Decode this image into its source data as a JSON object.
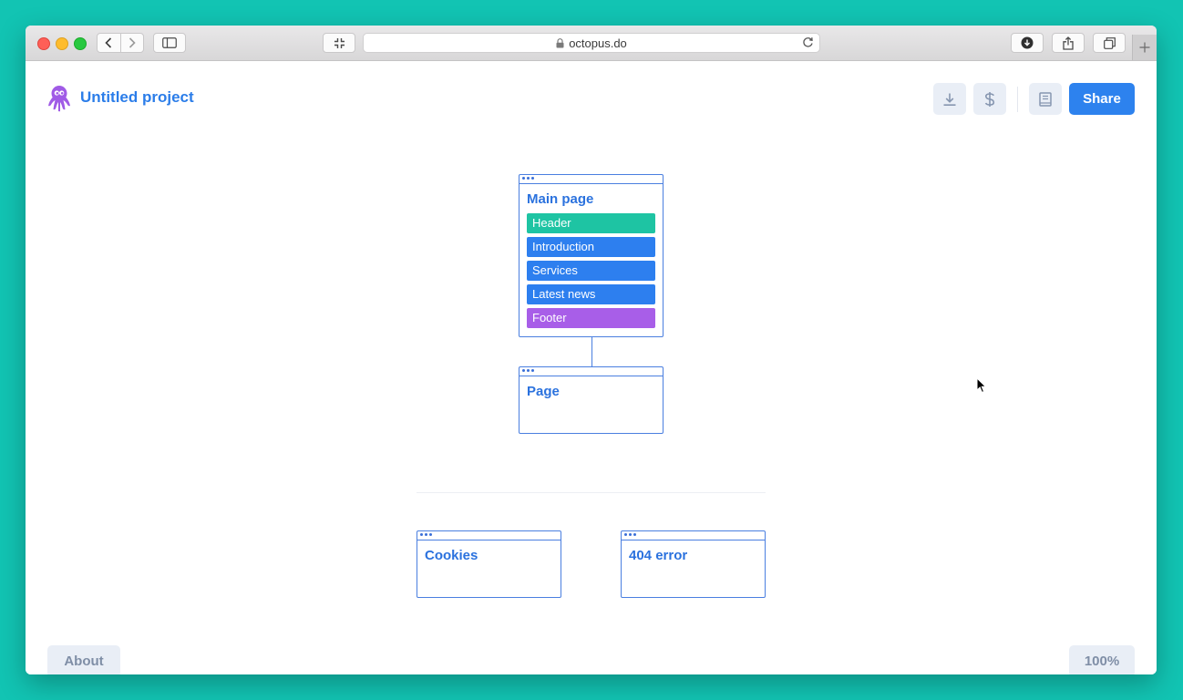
{
  "browser": {
    "url": "octopus.do"
  },
  "header": {
    "project_title": "Untitled project",
    "share_label": "Share"
  },
  "sitemap": {
    "main_card": {
      "title": "Main page",
      "blocks": [
        {
          "label": "Header",
          "color": "#1ec4a3"
        },
        {
          "label": "Introduction",
          "color": "#2d7fef"
        },
        {
          "label": "Services",
          "color": "#2d7fef"
        },
        {
          "label": "Latest news",
          "color": "#2d7fef"
        },
        {
          "label": "Footer",
          "color": "#a85ee8"
        }
      ]
    },
    "child_card": {
      "title": "Page"
    },
    "extra_cards": [
      {
        "title": "Cookies"
      },
      {
        "title": "404 error"
      }
    ]
  },
  "footer": {
    "about_label": "About",
    "zoom_label": "100%"
  },
  "colors": {
    "accent": "#2d82ee",
    "teal_block": "#1ec4a3",
    "blue_block": "#2d7fef",
    "purple_block": "#a85ee8",
    "logo": "#a05be6"
  },
  "icons": [
    "octopus-logo-icon",
    "download-icon",
    "dollar-icon",
    "book-icon"
  ]
}
